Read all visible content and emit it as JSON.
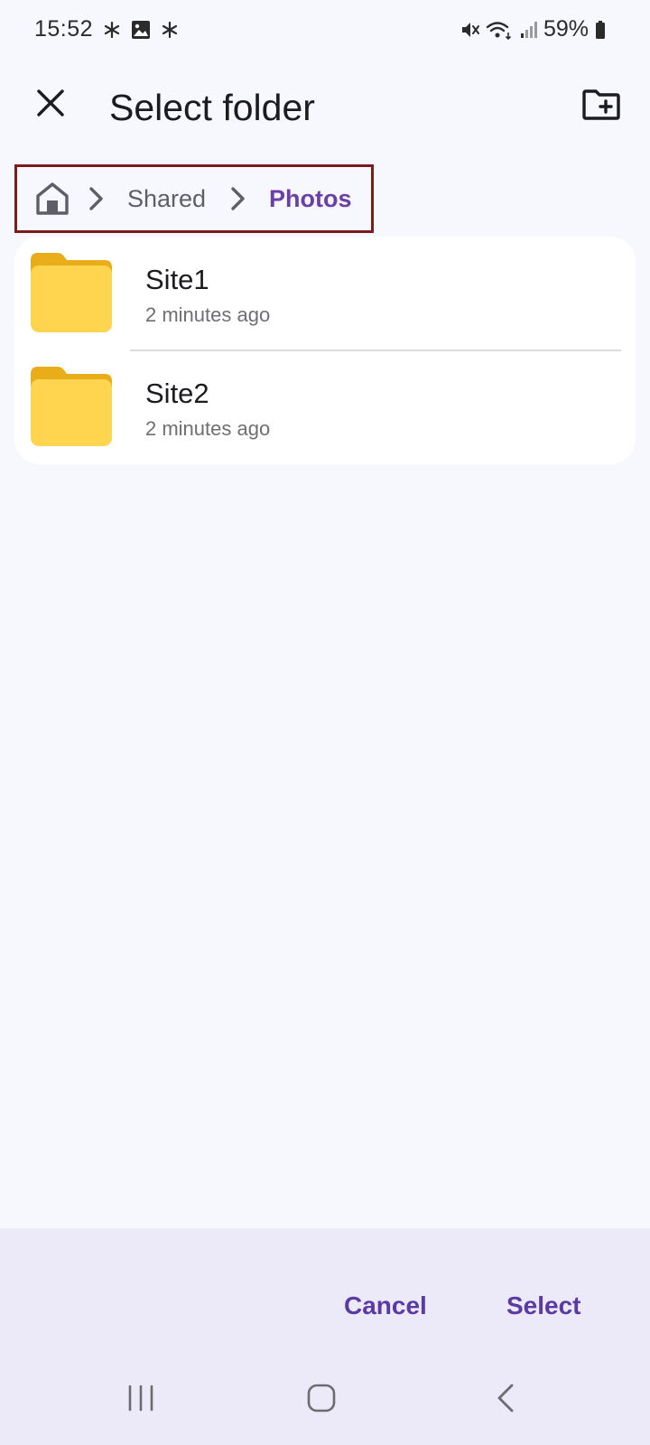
{
  "status_bar": {
    "time": "15:52",
    "battery": "59%",
    "left_icons": [
      "asterisk-icon",
      "image-icon",
      "asterisk-icon"
    ],
    "right_icons": [
      "mute-icon",
      "wifi-icon",
      "signal-icon",
      "battery-icon"
    ]
  },
  "app_bar": {
    "title": "Select folder",
    "close_icon": "close-icon",
    "new_folder_icon": "new-folder-icon"
  },
  "breadcrumb": {
    "home_icon": "home-icon",
    "items": [
      "Shared",
      "Photos"
    ],
    "active_color": "#6a3fa8",
    "highlight_border": "#7a1c1c"
  },
  "folders": [
    {
      "name": "Site1",
      "modified": "2 minutes ago"
    },
    {
      "name": "Site2",
      "modified": "2 minutes ago"
    }
  ],
  "actions": {
    "cancel": "Cancel",
    "select": "Select",
    "accent": "#5b3aa6"
  },
  "nav": {
    "icons": [
      "recent-apps-icon",
      "home-nav-icon",
      "back-icon"
    ]
  }
}
